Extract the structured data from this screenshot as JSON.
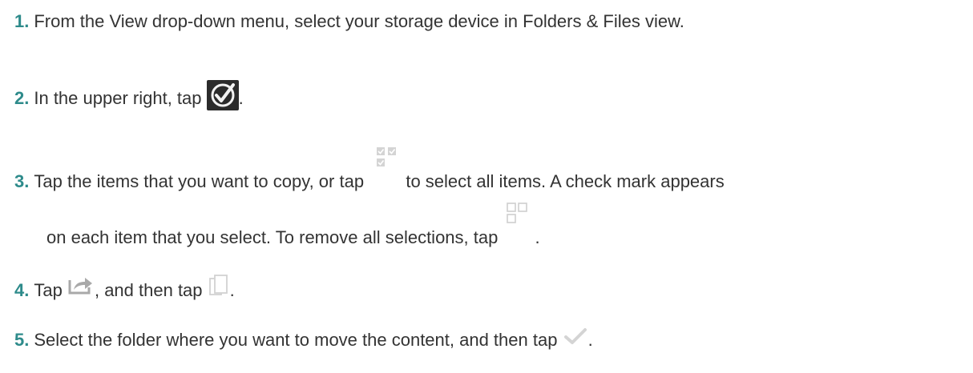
{
  "steps": [
    {
      "number": "1.",
      "text": "From the View drop-down menu, select your storage device in Folders & Files view."
    },
    {
      "number": "2.",
      "text_before": "In the upper right, tap",
      "text_after": ".",
      "icon": "select-mode-check-icon"
    },
    {
      "number": "3.",
      "text_before": "Tap the items that you want to copy, or tap",
      "text_middle": "to select all items. A check mark appears",
      "line2_before": "on each item that you select. To remove all selections, tap",
      "line2_after": ".",
      "icons": [
        "select-all-icon",
        "clear-selection-icon"
      ]
    },
    {
      "number": "4.",
      "text_before": "Tap",
      "text_middle": ", and then tap",
      "text_after": ".",
      "icons": [
        "share-icon",
        "copy-icon"
      ]
    },
    {
      "number": "5.",
      "text_before": "Select the folder where you want to move the content, and then tap",
      "text_after": ".",
      "icon": "done-check-icon"
    }
  ],
  "colors": {
    "step_number": "#2e8b8b",
    "body_text": "#333333",
    "icon_dark": "#2b2b2b",
    "icon_light": "#c8c8c8"
  }
}
